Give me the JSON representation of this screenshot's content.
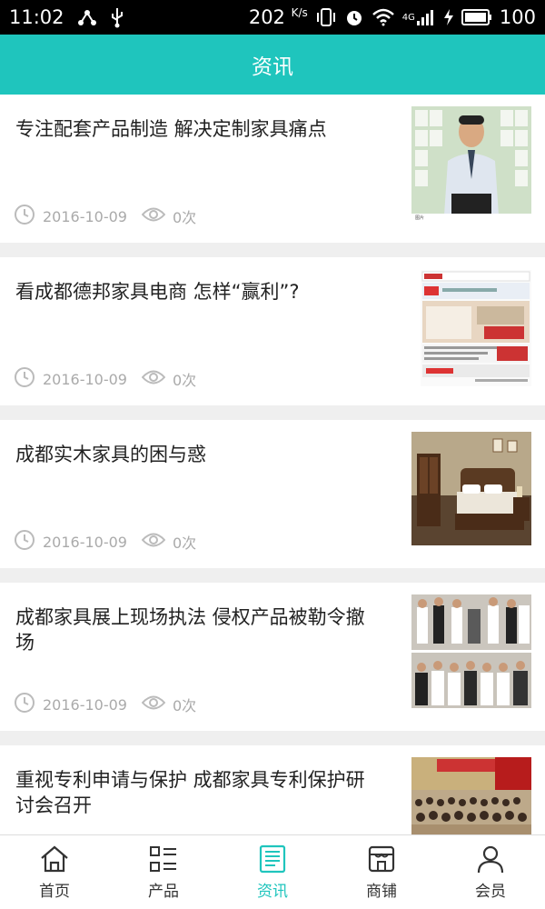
{
  "status_bar": {
    "time": "11:02",
    "speed": "202",
    "speed_unit": "K/s",
    "network": "4G",
    "battery": "100"
  },
  "header": {
    "title": "资讯"
  },
  "articles": [
    {
      "title": "专注配套产品制造 解决定制家具痛点",
      "date": "2016-10-09",
      "views": "0次",
      "thumb": "person-photo"
    },
    {
      "title": "看成都德邦家具电商 怎样“赢利”?",
      "date": "2016-10-09",
      "views": "0次",
      "thumb": "newspaper-ad"
    },
    {
      "title": "成都实木家具的困与惑",
      "date": "2016-10-09",
      "views": "0次",
      "thumb": "bedroom-furniture"
    },
    {
      "title": "成都家具展上现场执法 侵权产品被勒令撤场",
      "date": "2016-10-09",
      "views": "0次",
      "thumb": "expo-collage"
    },
    {
      "title": "重视专利申请与保护 成都家具专利保护研讨会召开",
      "date": "",
      "views": "",
      "thumb": "seminar-hall"
    }
  ],
  "nav": [
    {
      "label": "首页",
      "icon": "home-icon",
      "active": false
    },
    {
      "label": "产品",
      "icon": "grid-list-icon",
      "active": false
    },
    {
      "label": "资讯",
      "icon": "news-icon",
      "active": true
    },
    {
      "label": "商铺",
      "icon": "shop-icon",
      "active": false
    },
    {
      "label": "会员",
      "icon": "user-icon",
      "active": false
    }
  ],
  "colors": {
    "accent": "#1fc5bd",
    "background": "#efefef",
    "meta": "#aaaaaa"
  }
}
